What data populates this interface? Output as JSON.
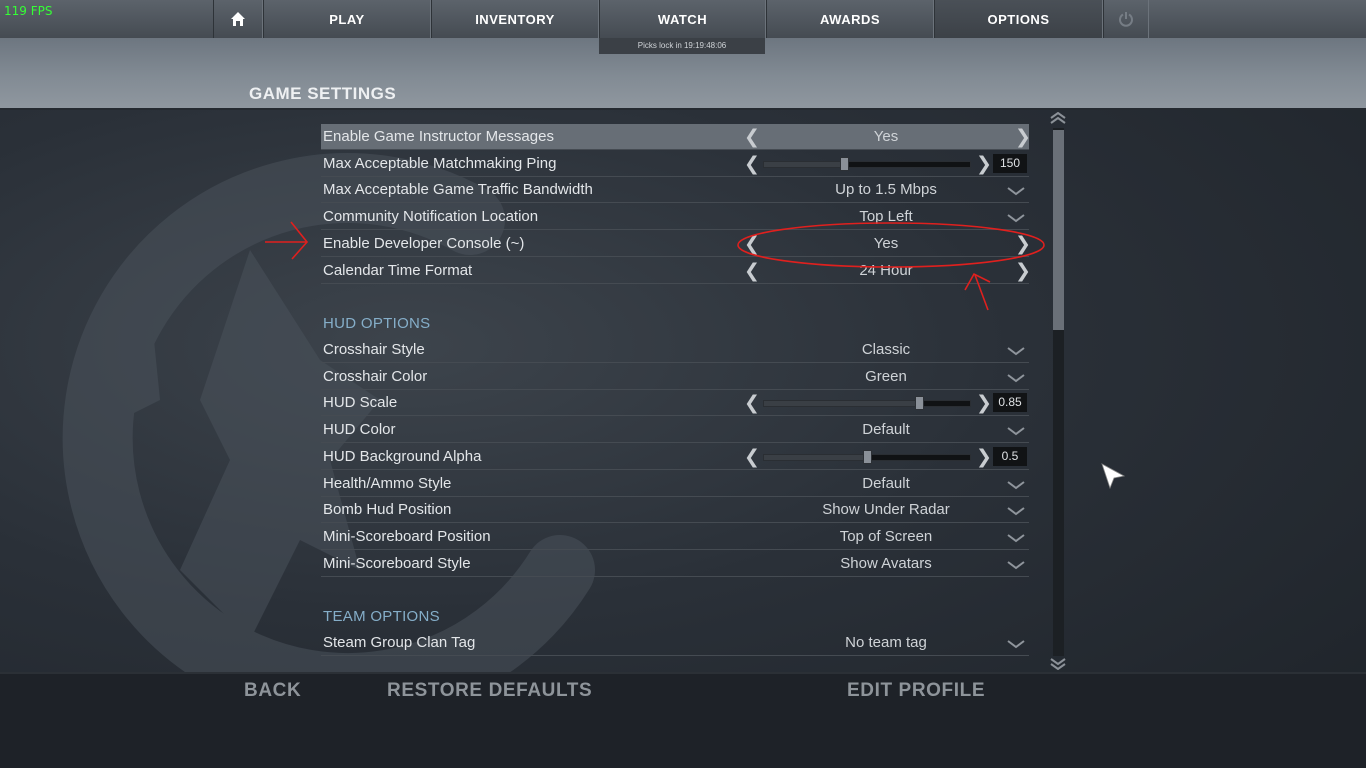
{
  "fps": "119 FPS",
  "nav": {
    "home_icon": "home-icon",
    "items": [
      "PLAY",
      "INVENTORY",
      "WATCH",
      "AWARDS",
      "OPTIONS"
    ],
    "power_icon": "power-icon",
    "watch_subtext": "Picks lock in 19:19:48:06"
  },
  "page_title": "GAME SETTINGS",
  "game": {
    "rows": [
      {
        "label": "Enable Game Instructor Messages",
        "value": "Yes",
        "control": "arrows"
      },
      {
        "label": "Max Acceptable Matchmaking Ping",
        "value": "150",
        "control": "slider",
        "level": 0.39
      },
      {
        "label": "Max Acceptable Game Traffic Bandwidth",
        "value": "Up to 1.5 Mbps",
        "control": "dropdown"
      },
      {
        "label": "Community Notification Location",
        "value": "Top Left",
        "control": "dropdown"
      },
      {
        "label": "Enable Developer Console (~)",
        "value": "Yes",
        "control": "arrows"
      },
      {
        "label": "Calendar Time Format",
        "value": "24 Hour",
        "control": "arrows"
      }
    ]
  },
  "hud": {
    "heading": "HUD OPTIONS",
    "rows": [
      {
        "label": "Crosshair Style",
        "value": "Classic",
        "control": "dropdown"
      },
      {
        "label": "Crosshair Color",
        "value": "Green",
        "control": "dropdown"
      },
      {
        "label": "HUD Scale",
        "value": "0.85",
        "control": "slider",
        "level": 0.75
      },
      {
        "label": "HUD Color",
        "value": "Default",
        "control": "dropdown"
      },
      {
        "label": "HUD Background Alpha",
        "value": "0.5",
        "control": "slider",
        "level": 0.5
      },
      {
        "label": "Health/Ammo Style",
        "value": "Default",
        "control": "dropdown"
      },
      {
        "label": "Bomb Hud Position",
        "value": "Show Under Radar",
        "control": "dropdown"
      },
      {
        "label": "Mini-Scoreboard Position",
        "value": "Top of Screen",
        "control": "dropdown"
      },
      {
        "label": "Mini-Scoreboard Style",
        "value": "Show Avatars",
        "control": "dropdown"
      }
    ]
  },
  "team": {
    "heading": "TEAM OPTIONS",
    "rows": [
      {
        "label": "Steam Group Clan Tag",
        "value": "No team tag",
        "control": "dropdown"
      }
    ]
  },
  "bottom": {
    "back": "BACK",
    "restore": "RESTORE DEFAULTS",
    "edit_profile": "EDIT PROFILE"
  },
  "colors": {
    "accent_heading": "#85aec9",
    "annotation_red": "#e0201e",
    "fps_green": "#35ff35"
  }
}
